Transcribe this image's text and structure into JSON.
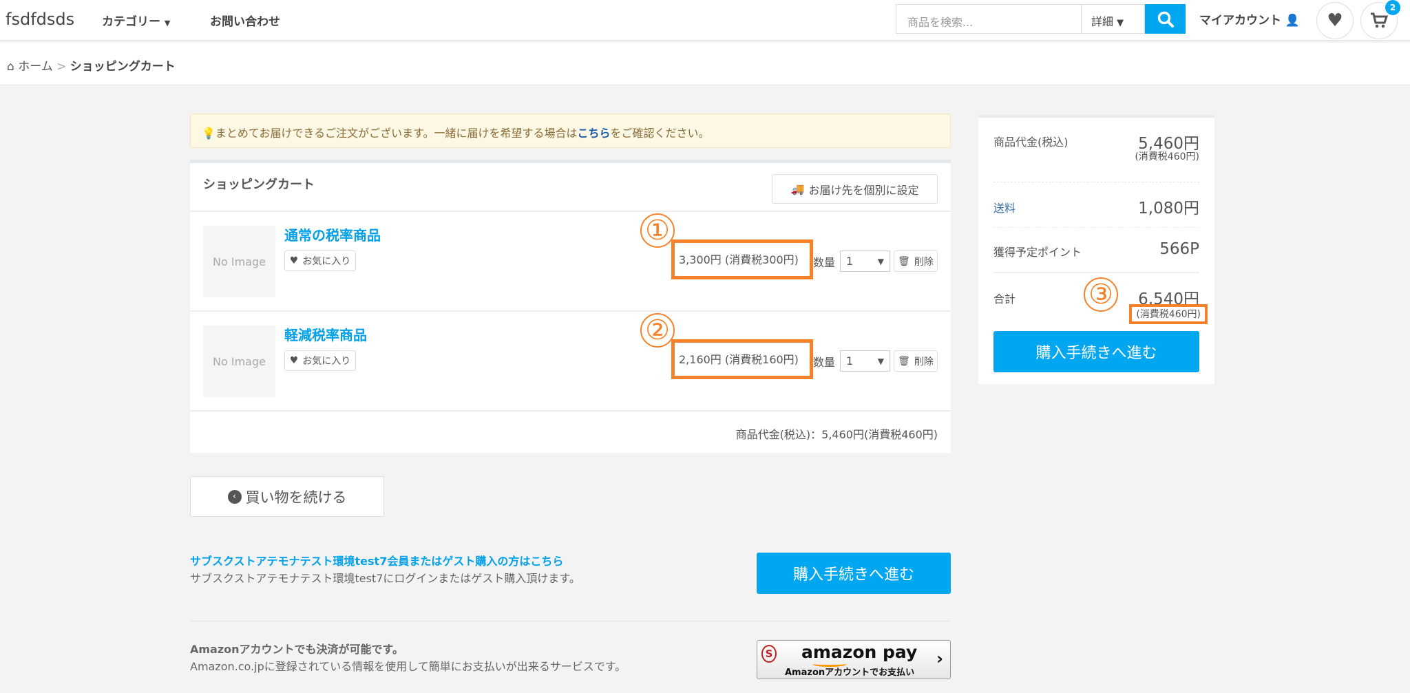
{
  "header": {
    "logo": "fsdfdsds",
    "nav": [
      {
        "label": "カテゴリー"
      },
      {
        "label": "お問い合わせ"
      }
    ],
    "search_placeholder": "商品を検索...",
    "detail_label": "詳細",
    "account_label": "マイアカウント",
    "cart_count": "2"
  },
  "breadcrumb": {
    "home": "ホーム",
    "sep": ">",
    "current": "ショッピングカート"
  },
  "notice": {
    "before": "まとめてお届けできるご注文がございます。一緒に届けを希望する場合は",
    "link": "こちら",
    "after": "をご確認ください。"
  },
  "cart": {
    "title": "ショッピングカート",
    "ship_button": "お届け先を個別に設定",
    "items": [
      {
        "marker": "①",
        "name": "通常の税率商品",
        "image": "No Image",
        "fav": "お気に入り",
        "price": "3,300円 (消費税300円)",
        "qty_label": "数量",
        "qty": "1",
        "delete": "削除"
      },
      {
        "marker": "②",
        "name": "軽減税率商品",
        "image": "No Image",
        "fav": "お気に入り",
        "price": "2,160円 (消費税160円)",
        "qty_label": "数量",
        "qty": "1",
        "delete": "削除"
      }
    ],
    "subtotal": "商品代金(税込)：5,460円(消費税460円)"
  },
  "continue_label": "買い物を続ける",
  "checkout": {
    "link": "サブスクストアテモナテスト環境test7会員またはゲスト購入の方はこちら",
    "desc": "サブスクストアテモナテスト環境test7にログインまたはゲスト購入頂けます。",
    "button": "購入手続きへ進む"
  },
  "amazon": {
    "title": "Amazonアカウントでも決済が可能です。",
    "desc": "Amazon.co.jpに登録されている情報を使用して簡単にお支払いが出来るサービスです。",
    "logo": "amazon pay",
    "sub": "Amazonアカウントでお支払い"
  },
  "summary": {
    "subtotal_label": "商品代金(税込)",
    "subtotal": "5,460円",
    "subtotal_tax": "(消費税460円)",
    "shipping_label": "送料",
    "shipping": "1,080円",
    "points_label": "獲得予定ポイント",
    "points": "566P",
    "total_label": "合計",
    "total": "6,540円",
    "total_tax": "(消費税460円)",
    "marker": "③",
    "button": "購入手続きへ進む"
  },
  "colors": {
    "accent": "#00a7f0",
    "highlight": "#f5822a"
  }
}
